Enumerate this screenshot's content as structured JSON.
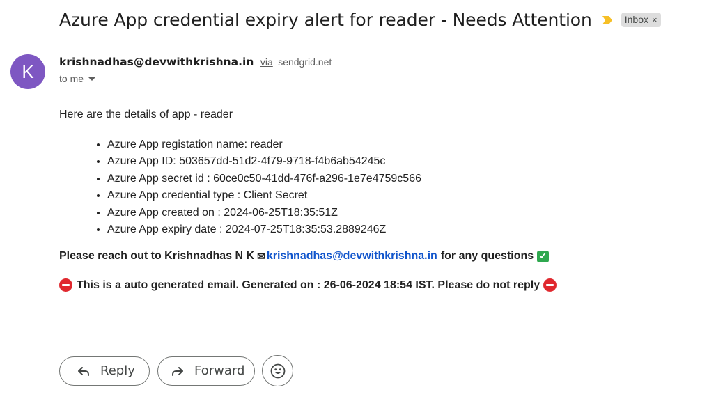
{
  "subject": {
    "title": "Azure App credential expiry alert for reader - Needs Attention",
    "label": "Inbox",
    "label_close": "×",
    "importance_icon": "importance-marker-icon"
  },
  "sender": {
    "avatar_letter": "K",
    "avatar_color": "#7e57c2",
    "email": "krishnadhas@devwithkrishna.in",
    "via_label": "via",
    "via_domain": "sendgrid.net",
    "to": "to me"
  },
  "body": {
    "intro": "Here are the details of app - reader",
    "details": [
      "Azure App registation name: reader",
      "Azure App ID: 503657dd-51d2-4f79-9718-f4b6ab54245c",
      "Azure App secret id : 60ce0c50-41dd-476f-a296-1e7e4759c566",
      "Azure App credential type : Client Secret",
      "Azure App created on : 2024-06-25T18:35:51Z",
      "Azure App expiry date : 2024-07-25T18:35:53.2889246Z"
    ],
    "contact_prefix": "Please reach out to Krishnadhas N K",
    "contact_email": "krishnadhas@devwithkrishna.in",
    "contact_suffix": "for any questions",
    "notice": "This is a auto generated email. Generated on : 26-06-2024 18:54 IST. Please do not reply"
  },
  "actions": {
    "reply": "Reply",
    "forward": "Forward",
    "emoji_icon": "smiley-icon"
  },
  "colors": {
    "link": "#1155cc",
    "alert": "#e0282e",
    "check": "#2fa84f",
    "importance": "#f6bf26"
  }
}
